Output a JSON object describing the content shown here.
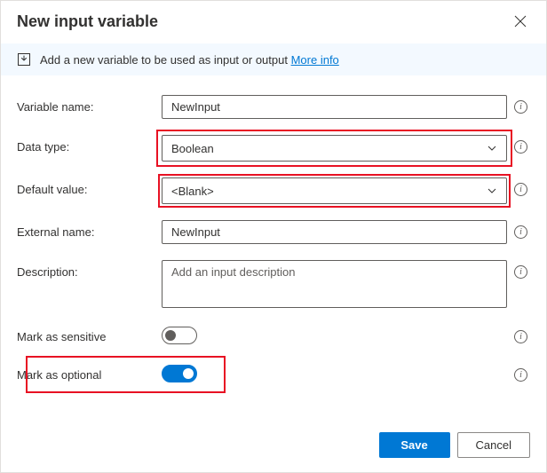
{
  "dialog": {
    "title": "New input variable",
    "banner": {
      "text": "Add a new variable to be used as input or output",
      "link": "More info"
    }
  },
  "form": {
    "variable_name": {
      "label": "Variable name:",
      "value": "NewInput"
    },
    "data_type": {
      "label": "Data type:",
      "value": "Boolean"
    },
    "default_value": {
      "label": "Default value:",
      "value": "<Blank>"
    },
    "external_name": {
      "label": "External name:",
      "value": "NewInput"
    },
    "description": {
      "label": "Description:",
      "placeholder": "Add an input description"
    },
    "mark_sensitive": {
      "label": "Mark as sensitive"
    },
    "mark_optional": {
      "label": "Mark as optional"
    }
  },
  "footer": {
    "save": "Save",
    "cancel": "Cancel"
  }
}
